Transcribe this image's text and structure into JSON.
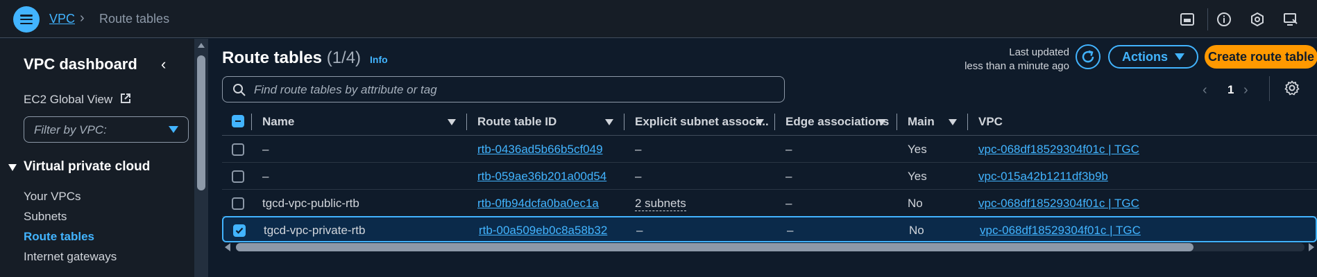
{
  "breadcrumb": {
    "parent": "VPC",
    "separator": "›",
    "current": "Route tables"
  },
  "topbar_icons": [
    "cloudshell-icon",
    "info-icon",
    "notifications-icon",
    "feedback-icon"
  ],
  "sidebar": {
    "title": "VPC dashboard",
    "collapse": "‹",
    "ec2_global_view": "EC2 Global View",
    "filter_placeholder": "Filter by VPC:",
    "section_title": "Virtual private cloud",
    "items": [
      {
        "label": "Your VPCs",
        "active": false
      },
      {
        "label": "Subnets",
        "active": false
      },
      {
        "label": "Route tables",
        "active": true
      },
      {
        "label": "Internet gateways",
        "active": false
      }
    ]
  },
  "main": {
    "title": "Route tables",
    "count": "(1/4)",
    "info": "Info",
    "last_updated_line1": "Last updated",
    "last_updated_line2": "less than a minute ago",
    "actions_label": "Actions",
    "create_label": "Create route table",
    "search_placeholder": "Find route tables by attribute or tag",
    "pager": {
      "prev": "‹",
      "page": "1",
      "next": "›"
    }
  },
  "table": {
    "columns": [
      "Name",
      "Route table ID",
      "Explicit subnet associ...",
      "Edge associations",
      "Main",
      "VPC"
    ],
    "rows": [
      {
        "name": "–",
        "id": "rtb-0436ad5b66b5cf049",
        "subnet": "–",
        "edge": "–",
        "main": "Yes",
        "vpc": "vpc-068df18529304f01c | TGC",
        "selected": false
      },
      {
        "name": "–",
        "id": "rtb-059ae36b201a00d54",
        "subnet": "–",
        "edge": "–",
        "main": "Yes",
        "vpc": "vpc-015a42b1211df3b9b",
        "selected": false
      },
      {
        "name": "tgcd-vpc-public-rtb",
        "id": "rtb-0fb94dcfa0ba0ec1a",
        "subnet": "2 subnets",
        "edge": "–",
        "main": "No",
        "vpc": "vpc-068df18529304f01c | TGC",
        "selected": false
      },
      {
        "name": "tgcd-vpc-private-rtb",
        "id": "rtb-00a509eb0c8a58b32",
        "subnet": "–",
        "edge": "–",
        "main": "No",
        "vpc": "vpc-068df18529304f01c | TGC",
        "selected": true
      }
    ]
  },
  "colors": {
    "accent": "#42b4ff",
    "primary_button": "#ff9900",
    "background": "#0f1b2a",
    "panel": "#161d26"
  }
}
